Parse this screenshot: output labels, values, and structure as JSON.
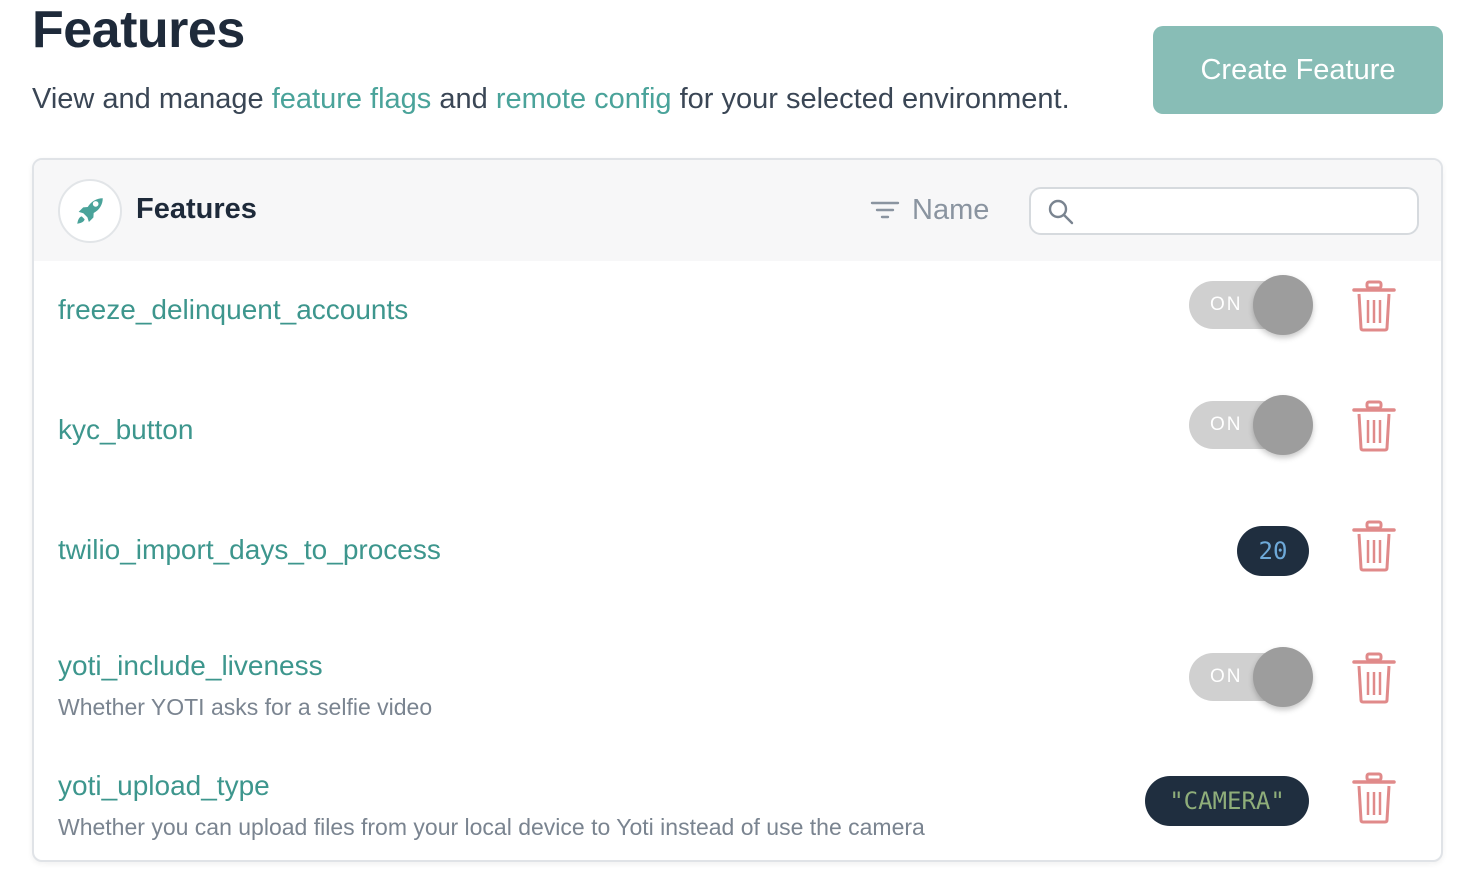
{
  "header": {
    "title": "Features",
    "subtitle_pre": "View and manage ",
    "subtitle_link1": "feature flags",
    "subtitle_mid": " and ",
    "subtitle_link2": "remote config",
    "subtitle_post": " for your selected environment.",
    "create_label": "Create Feature"
  },
  "panel": {
    "title": "Features",
    "sort_label": "Name",
    "search_value": "",
    "icon": "rocket-icon"
  },
  "colors": {
    "accent": "#4aa39a",
    "button": "#88bdb6",
    "delete": "#e08a8a",
    "pill_bg": "#1f2e3f"
  },
  "features": [
    {
      "name": "freeze_delinquent_accounts",
      "description": "",
      "type": "toggle",
      "toggle_label": "ON"
    },
    {
      "name": "kyc_button",
      "description": "",
      "type": "toggle",
      "toggle_label": "ON"
    },
    {
      "name": "twilio_import_days_to_process",
      "description": "",
      "type": "value",
      "value": "20"
    },
    {
      "name": "yoti_include_liveness",
      "description": "Whether YOTI asks for a selfie video",
      "type": "toggle",
      "toggle_label": "ON"
    },
    {
      "name": "yoti_upload_type",
      "description": "Whether you can upload files from your local device to Yoti instead of use the camera",
      "type": "value",
      "value": "\"CAMERA\""
    }
  ]
}
